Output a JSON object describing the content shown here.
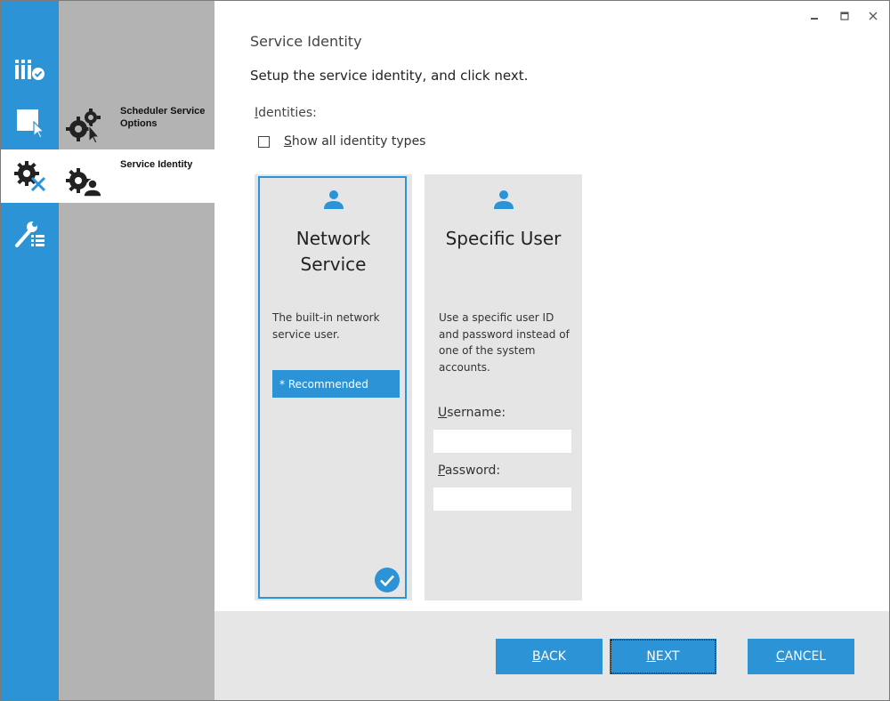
{
  "rail": {
    "items": [
      {
        "icon": "product-logo-check-icon",
        "active": false
      },
      {
        "icon": "select-cursor-icon",
        "active": false
      },
      {
        "icon": "gear-tools-icon",
        "active": true
      },
      {
        "icon": "wrench-list-icon",
        "active": false
      }
    ]
  },
  "steps": [
    {
      "label": "Scheduler Service Options",
      "icon": "gears-cursor-icon",
      "active": false
    },
    {
      "label": "Service Identity",
      "icon": "gears-user-icon",
      "active": true
    }
  ],
  "window": {
    "minimize": "▁",
    "maximize": "□",
    "close": "✕"
  },
  "page": {
    "title": "Service Identity",
    "instruction": "Setup the service identity, and click next.",
    "identities_label": "Identities:",
    "show_all_label": "Show all identity types"
  },
  "cards": {
    "network": {
      "title": "Network Service",
      "description": "The built-in network service user.",
      "recommended": "* Recommended",
      "selected": true
    },
    "specific": {
      "title": "Specific User",
      "description": "Use a specific user ID and password instead of one of the system accounts.",
      "username_label": "Username:",
      "username_value": "",
      "password_label": "Password:",
      "password_value": ""
    }
  },
  "footer": {
    "back_label": "BACK",
    "next_label": "NEXT",
    "cancel_label": "CANCEL"
  },
  "colors": {
    "accent": "#2b93d6",
    "steps_bg": "#b3b3b3",
    "footer_bg": "#e6e6e6",
    "card_bg": "#e5e5e5"
  }
}
